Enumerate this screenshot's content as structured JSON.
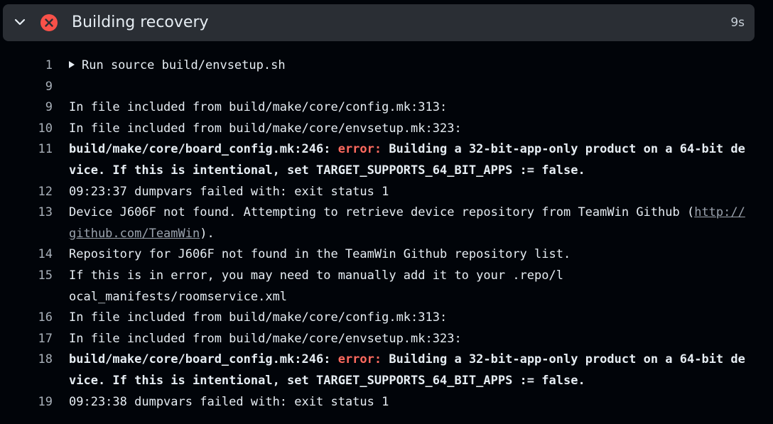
{
  "step": {
    "title": "Building recovery",
    "duration": "9s",
    "status_color": "#f85149",
    "icons": {
      "toggle": "chevron-down-icon",
      "status": "x-circle-fail-icon"
    }
  },
  "log": {
    "line1": {
      "num": "1",
      "text": "Run source build/envsetup.sh"
    },
    "line2": {
      "num": "9",
      "text": ""
    },
    "line3": {
      "num": "9",
      "text": "In file included from build/make/core/config.mk:313:"
    },
    "line4": {
      "num": "10",
      "text": "In file included from build/make/core/envsetup.mk:323:"
    },
    "line5": {
      "num": "11",
      "path": "build/make/core/board_config.mk:246: ",
      "error": "error:",
      "msg": " Building a 32-bit-app-only product on a 64-bit device. If this is intentional, set TARGET_SUPPORTS_64_BIT_APPS := false."
    },
    "line6": {
      "num": "12",
      "text": "09:23:37 dumpvars failed with: exit status 1"
    },
    "line7": {
      "num": "13",
      "text": "Device J606F not found. Attempting to retrieve device repository from TeamWin Github (",
      "link": "http://github.com/TeamWin",
      "after": ")."
    },
    "line8": {
      "num": "14",
      "text": "Repository for J606F not found in the TeamWin Github repository list."
    },
    "line9": {
      "num": "15",
      "text": "If this is in error, you may need to manually add it to your .repo/local_manifests/roomservice.xml"
    },
    "line10": {
      "num": "16",
      "text": "In file included from build/make/core/config.mk:313:"
    },
    "line11": {
      "num": "17",
      "text": "In file included from build/make/core/envsetup.mk:323:"
    },
    "line12": {
      "num": "18",
      "path": "build/make/core/board_config.mk:246: ",
      "error": "error:",
      "msg": " Building a 32-bit-app-only product on a 64-bit device. If this is intentional, set TARGET_SUPPORTS_64_BIT_APPS := false."
    },
    "line13": {
      "num": "19",
      "text": "09:23:38 dumpvars failed with: exit status 1"
    }
  }
}
